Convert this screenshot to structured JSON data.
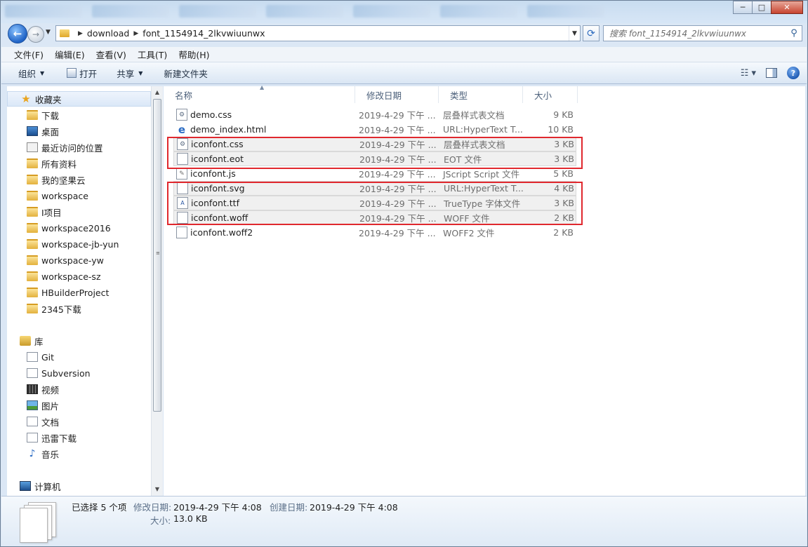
{
  "window": {
    "controls": {
      "minimize": "─",
      "maximize": "□",
      "close": "✕"
    }
  },
  "address": {
    "crumbs": [
      "download",
      "font_1154914_2lkvwiuunwx"
    ],
    "search_placeholder": "搜索 font_1154914_2lkvwiuunwx"
  },
  "menu": [
    "文件(F)",
    "编辑(E)",
    "查看(V)",
    "工具(T)",
    "帮助(H)"
  ],
  "toolbar": {
    "organize": "组织",
    "open": "打开",
    "share": "共享",
    "new_folder": "新建文件夹"
  },
  "nav": {
    "favorites_header": "收藏夹",
    "favorites": [
      "下载",
      "桌面",
      "最近访问的位置",
      "所有资料",
      "我的坚果云",
      "workspace",
      "I项目",
      "workspace2016",
      "workspace-jb-yun",
      "workspace-yw",
      "workspace-sz",
      "HBuilderProject",
      "2345下载"
    ],
    "libraries_header": "库",
    "libraries": [
      "Git",
      "Subversion",
      "视频",
      "图片",
      "文档",
      "迅雷下载",
      "音乐"
    ],
    "computer_header": "计算机"
  },
  "columns": {
    "name": "名称",
    "date": "修改日期",
    "type": "类型",
    "size": "大小"
  },
  "files": [
    {
      "name": "demo.css",
      "date": "2019-4-29 下午 ...",
      "type": "层叠样式表文档",
      "size": "9 KB",
      "icon": "css-file-icon",
      "selected": false
    },
    {
      "name": "demo_index.html",
      "date": "2019-4-29 下午 ...",
      "type": "URL:HyperText T...",
      "size": "10 KB",
      "icon": "ie-html-icon",
      "selected": false
    },
    {
      "name": "iconfont.css",
      "date": "2019-4-29 下午 ...",
      "type": "层叠样式表文档",
      "size": "3 KB",
      "icon": "css-file-icon",
      "selected": true
    },
    {
      "name": "iconfont.eot",
      "date": "2019-4-29 下午 ...",
      "type": "EOT 文件",
      "size": "3 KB",
      "icon": "blank-file-icon",
      "selected": true
    },
    {
      "name": "iconfont.js",
      "date": "2019-4-29 下午 ...",
      "type": "JScript Script 文件",
      "size": "5 KB",
      "icon": "js-file-icon",
      "selected": false
    },
    {
      "name": "iconfont.svg",
      "date": "2019-4-29 下午 ...",
      "type": "URL:HyperText T...",
      "size": "4 KB",
      "icon": "blank-file-icon",
      "selected": true
    },
    {
      "name": "iconfont.ttf",
      "date": "2019-4-29 下午 ...",
      "type": "TrueType 字体文件",
      "size": "3 KB",
      "icon": "ttf-file-icon",
      "selected": true
    },
    {
      "name": "iconfont.woff",
      "date": "2019-4-29 下午 ...",
      "type": "WOFF 文件",
      "size": "2 KB",
      "icon": "blank-file-icon",
      "selected": true
    },
    {
      "name": "iconfont.woff2",
      "date": "2019-4-29 下午 ...",
      "type": "WOFF2 文件",
      "size": "2 KB",
      "icon": "blank-file-icon",
      "selected": false
    }
  ],
  "details": {
    "selected_count": "已选择 5 个项",
    "modified_label": "修改日期:",
    "modified_value": "2019-4-29 下午 4:08",
    "created_label": "创建日期:",
    "created_value": "2019-4-29 下午 4:08",
    "size_label": "大小:",
    "size_value": "13.0 KB"
  },
  "colors": {
    "highlight_box": "#e0282e",
    "selection_bg": "#f0f0f0",
    "window_frame": "#cfe0f2"
  }
}
